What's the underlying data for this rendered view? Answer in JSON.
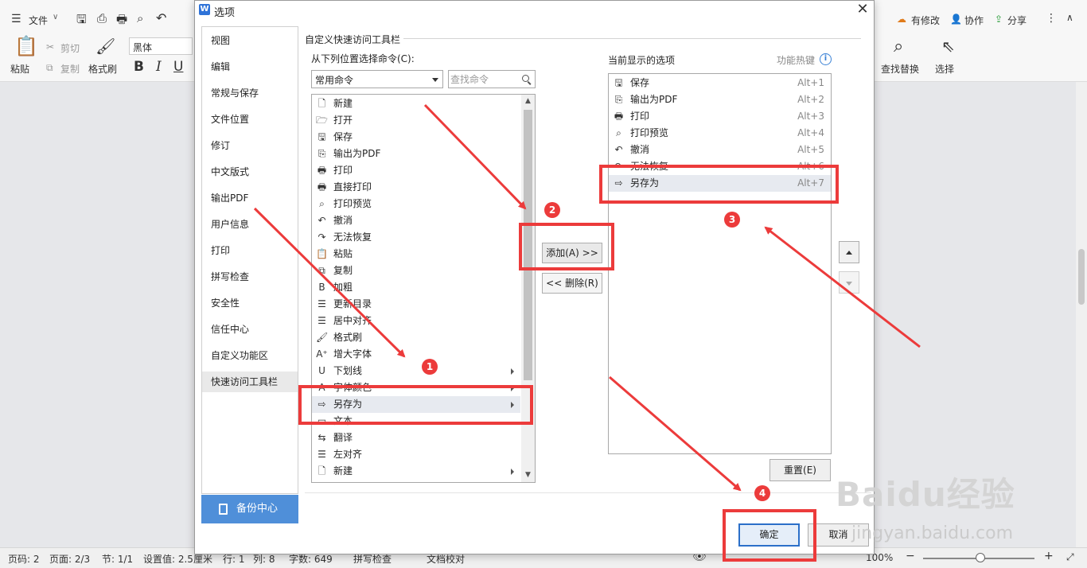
{
  "toolbar": {
    "file_menu": "文件",
    "paste": "粘贴",
    "cut": "剪切",
    "copy": "复制",
    "format_painter": "格式刷",
    "font_name": "黑体",
    "bold": "B",
    "italic": "I",
    "underline": "U",
    "has_changes": "有修改",
    "collaborate": "协作",
    "share": "分享",
    "find_replace": "查找替换",
    "select": "选择"
  },
  "statusbar": {
    "page_number": "页码: 2",
    "pages": "页面: 2/3",
    "section": "节: 1/1",
    "setting": "设置值: 2.5厘米",
    "row": "行: 1",
    "column": "列: 8",
    "word_count": "字数: 649",
    "spell_check": "拼写检查",
    "doc_proof": "文档校对",
    "zoom": "100%"
  },
  "dialog": {
    "title": "选项",
    "nav_items": [
      "视图",
      "编辑",
      "常规与保存",
      "文件位置",
      "修订",
      "中文版式",
      "输出PDF",
      "用户信息",
      "打印",
      "拼写检查",
      "安全性",
      "信任中心",
      "自定义功能区",
      "快速访问工具栏"
    ],
    "backup_center": "备份中心",
    "section_title": "自定义快速访问工具栏",
    "source_label": "从下列位置选择命令(C):",
    "source_value": "常用命令",
    "search_placeholder": "查找命令",
    "commands": [
      {
        "label": "新建",
        "icon": "new-icon",
        "sub": false
      },
      {
        "label": "打开",
        "icon": "folder-open-icon",
        "sub": false
      },
      {
        "label": "保存",
        "icon": "save-icon",
        "sub": false
      },
      {
        "label": "输出为PDF",
        "icon": "pdf-icon",
        "sub": false
      },
      {
        "label": "打印",
        "icon": "print-icon",
        "sub": false
      },
      {
        "label": "直接打印",
        "icon": "direct-print-icon",
        "sub": false
      },
      {
        "label": "打印预览",
        "icon": "print-preview-icon",
        "sub": false
      },
      {
        "label": "撤消",
        "icon": "undo-icon",
        "sub": false
      },
      {
        "label": "无法恢复",
        "icon": "redo-icon",
        "sub": false
      },
      {
        "label": "粘贴",
        "icon": "paste-icon",
        "sub": false
      },
      {
        "label": "复制",
        "icon": "copy-icon",
        "sub": false
      },
      {
        "label": "加粗",
        "icon": "bold-icon",
        "sub": false
      },
      {
        "label": "更新目录",
        "icon": "update-toc-icon",
        "sub": false
      },
      {
        "label": "居中对齐",
        "icon": "align-center-icon",
        "sub": false
      },
      {
        "label": "格式刷",
        "icon": "format-painter-icon",
        "sub": false
      },
      {
        "label": "增大字体",
        "icon": "font-size-increase-icon",
        "sub": false
      },
      {
        "label": "下划线",
        "icon": "underline-icon",
        "sub": true
      },
      {
        "label": "字体颜色",
        "icon": "font-color-icon",
        "sub": true
      },
      {
        "label": "另存为",
        "icon": "save-as-icon",
        "sub": true
      },
      {
        "label": "文本",
        "icon": "text-icon",
        "sub": false
      },
      {
        "label": "翻译",
        "icon": "translate-icon",
        "sub": false
      },
      {
        "label": "左对齐",
        "icon": "align-left-icon",
        "sub": false
      },
      {
        "label": "新建",
        "icon": "new-icon",
        "sub": true
      }
    ],
    "add_button": "添加(A) >>",
    "remove_button": "<< 删除(R)",
    "current_label": "当前显示的选项",
    "hotkey_label": "功能热键",
    "current_items": [
      {
        "label": "保存",
        "icon": "save-icon",
        "hotkey": "Alt+1"
      },
      {
        "label": "输出为PDF",
        "icon": "pdf-icon",
        "hotkey": "Alt+2"
      },
      {
        "label": "打印",
        "icon": "print-icon",
        "hotkey": "Alt+3"
      },
      {
        "label": "打印预览",
        "icon": "print-preview-icon",
        "hotkey": "Alt+4"
      },
      {
        "label": "撤消",
        "icon": "undo-icon",
        "hotkey": "Alt+5"
      },
      {
        "label": "无法恢复",
        "icon": "redo-icon",
        "hotkey": "Alt+6"
      },
      {
        "label": "另存为",
        "icon": "save-as-icon",
        "hotkey": "Alt+7"
      }
    ],
    "reset_button": "重置(E)",
    "ok_button": "确定",
    "cancel_button": "取消"
  },
  "annotations": {
    "steps": [
      "1",
      "2",
      "3",
      "4"
    ],
    "color": "#ec3b3b"
  },
  "watermark": {
    "logo": "Baidu经验",
    "url": "jingyan.baidu.com"
  }
}
